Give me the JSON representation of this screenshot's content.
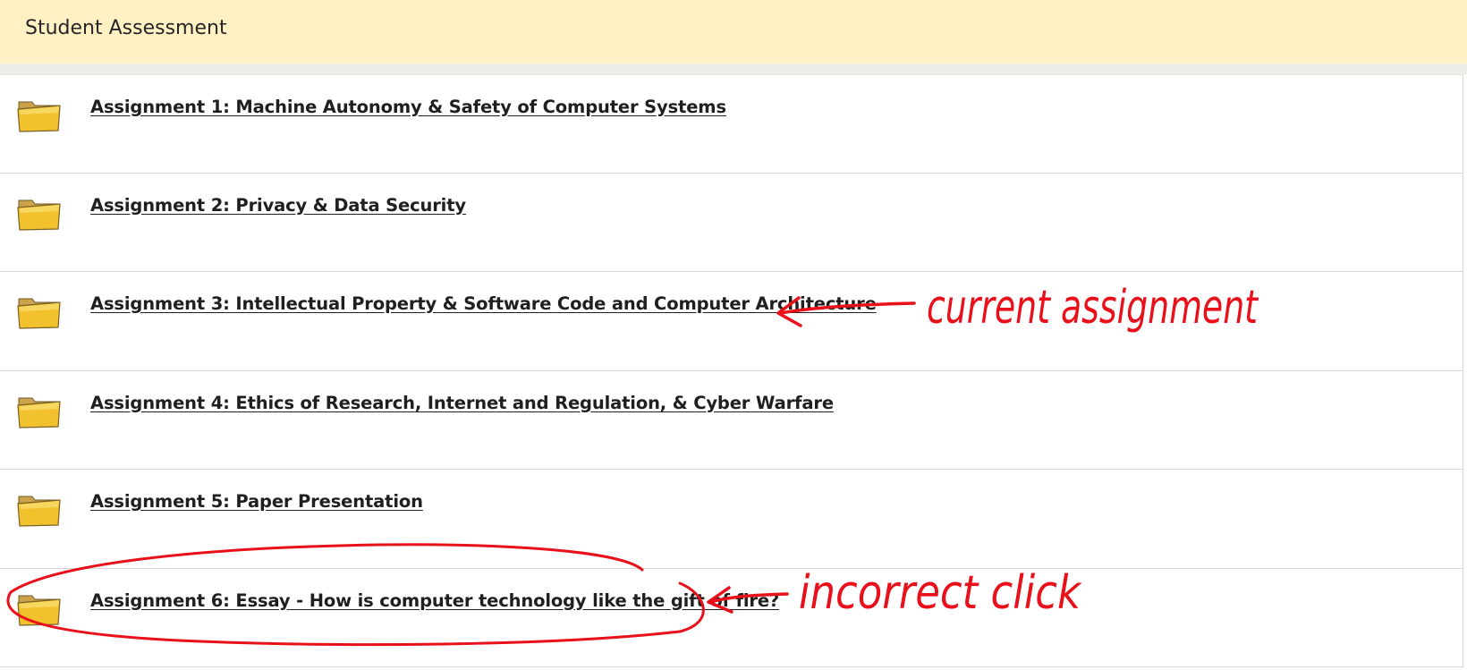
{
  "header": {
    "title": "Student Assessment"
  },
  "assignments": [
    {
      "label": "Assignment 1: Machine Autonomy & Safety of Computer Systems",
      "icon": "folder-icon"
    },
    {
      "label": "Assignment 2: Privacy & Data Security",
      "icon": "folder-icon"
    },
    {
      "label": "Assignment 3: Intellectual Property & Software Code and Computer Architecture",
      "icon": "folder-icon"
    },
    {
      "label": "Assignment 4: Ethics of Research, Internet and Regulation, & Cyber Warfare",
      "icon": "folder-icon"
    },
    {
      "label": "Assignment 5: Paper Presentation",
      "icon": "folder-icon"
    },
    {
      "label": "Assignment 6: Essay - How is computer technology like the gift of fire?",
      "icon": "folder-icon"
    }
  ],
  "annotations": {
    "current": "current assignment",
    "incorrect": "incorrect click",
    "color": "#e8101a"
  },
  "colors": {
    "header_bg": "#fff1c4",
    "folder_fill": "#f2c22e",
    "link_text": "#1f1f1f"
  }
}
